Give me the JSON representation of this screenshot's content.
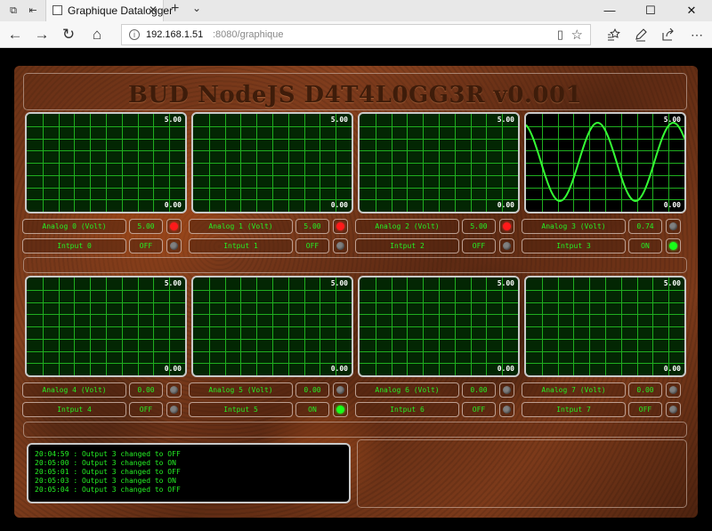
{
  "browser": {
    "tab_title": "Graphique Datalogger",
    "url_host": "192.168.1.51",
    "url_path": ":8080/graphique",
    "tab_close": "✕",
    "new_tab": "+",
    "tab_dropdown": "⌄",
    "window": {
      "minimize": "—",
      "maximize": "☐",
      "close": "✕"
    },
    "nav": {
      "back": "←",
      "forward": "→",
      "refresh": "↻",
      "home": "⌂"
    },
    "toolbar_icons": [
      "reading-view-icon",
      "favorite-star-icon",
      "favorites-hub-icon",
      "pen-notes-icon",
      "share-icon",
      "more-icon"
    ]
  },
  "app": {
    "title": "BUD NodeJS D4T4L0GG3R v0.001",
    "scope_max": "5.00",
    "scope_min": "0.00",
    "channels": [
      {
        "analog_label": "Analog 0 (Volt)",
        "value": "5.00",
        "analog_led": "red",
        "input_label": "Intput 0",
        "state": "OFF",
        "input_led": "off"
      },
      {
        "analog_label": "Analog 1 (Volt)",
        "value": "5.00",
        "analog_led": "red",
        "input_label": "Intput 1",
        "state": "OFF",
        "input_led": "off"
      },
      {
        "analog_label": "Analog 2 (Volt)",
        "value": "5.00",
        "analog_led": "red",
        "input_label": "Intput 2",
        "state": "OFF",
        "input_led": "off"
      },
      {
        "analog_label": "Analog 3 (Volt)",
        "value": "0.74",
        "analog_led": "off",
        "input_label": "Intput 3",
        "state": "ON",
        "input_led": "green"
      },
      {
        "analog_label": "Analog 4 (Volt)",
        "value": "0.00",
        "analog_led": "off",
        "input_label": "Intput 4",
        "state": "OFF",
        "input_led": "off"
      },
      {
        "analog_label": "Analog 5 (Volt)",
        "value": "0.00",
        "analog_led": "off",
        "input_label": "Intput 5",
        "state": "ON",
        "input_led": "green"
      },
      {
        "analog_label": "Analog 6 (Volt)",
        "value": "0.00",
        "analog_led": "off",
        "input_label": "Intput 6",
        "state": "OFF",
        "input_led": "off"
      },
      {
        "analog_label": "Analog 7 (Volt)",
        "value": "0.00",
        "analog_led": "off",
        "input_label": "Intput 7",
        "state": "OFF",
        "input_led": "off"
      }
    ],
    "log": [
      "20:04:59 : Output 3 changed to OFF",
      "20:05:00 : Output 3 changed to ON",
      "20:05:01 : Output 3 changed to OFF",
      "20:05:03 : Output 3 changed to ON",
      "20:05:04 : Output 3 changed to OFF"
    ],
    "colors": {
      "trace": "#35ff35",
      "grid": "#1fae1f",
      "scope_bg": "#032603",
      "led_red": "#ff1a1a",
      "led_green": "#19ff19",
      "led_off": "#808080",
      "text_green": "#24f024"
    }
  }
}
